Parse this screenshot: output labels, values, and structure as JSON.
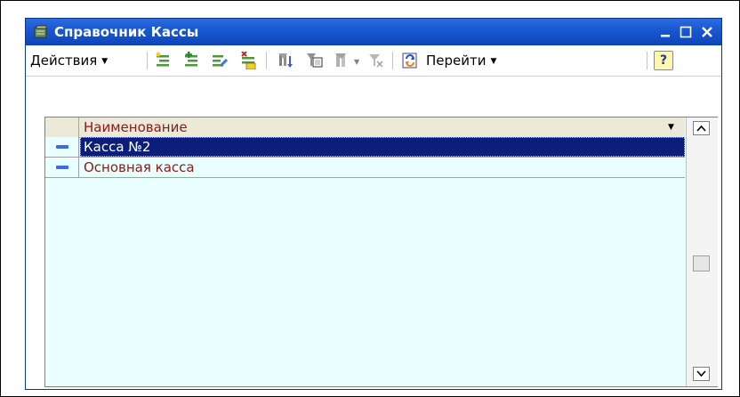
{
  "window": {
    "title": "Справочник Кассы",
    "minimize_icon": "minimize-icon",
    "maximize_icon": "maximize-icon",
    "close_icon": "close-icon"
  },
  "toolbar": {
    "actions_label": "Действия",
    "goto_label": "Перейти",
    "help_label": "?",
    "icons": [
      "add-item-icon",
      "add-group-icon",
      "edit-item-icon",
      "mark-delete-icon",
      "filter-icon",
      "filter-by-value-icon",
      "filter-history-icon",
      "clear-filter-icon",
      "refresh-icon",
      "help-icon"
    ]
  },
  "grid": {
    "column_header": "Наименование",
    "rows": [
      {
        "name": "Касса №2",
        "selected": true
      },
      {
        "name": "Основная касса",
        "selected": false
      }
    ]
  },
  "colors": {
    "titlebar": "#1856d0",
    "selection": "#0a1e7a",
    "grid_background": "#e8fffe",
    "row_text": "#8b1a1a",
    "row_marker": "#3a6ae8"
  }
}
